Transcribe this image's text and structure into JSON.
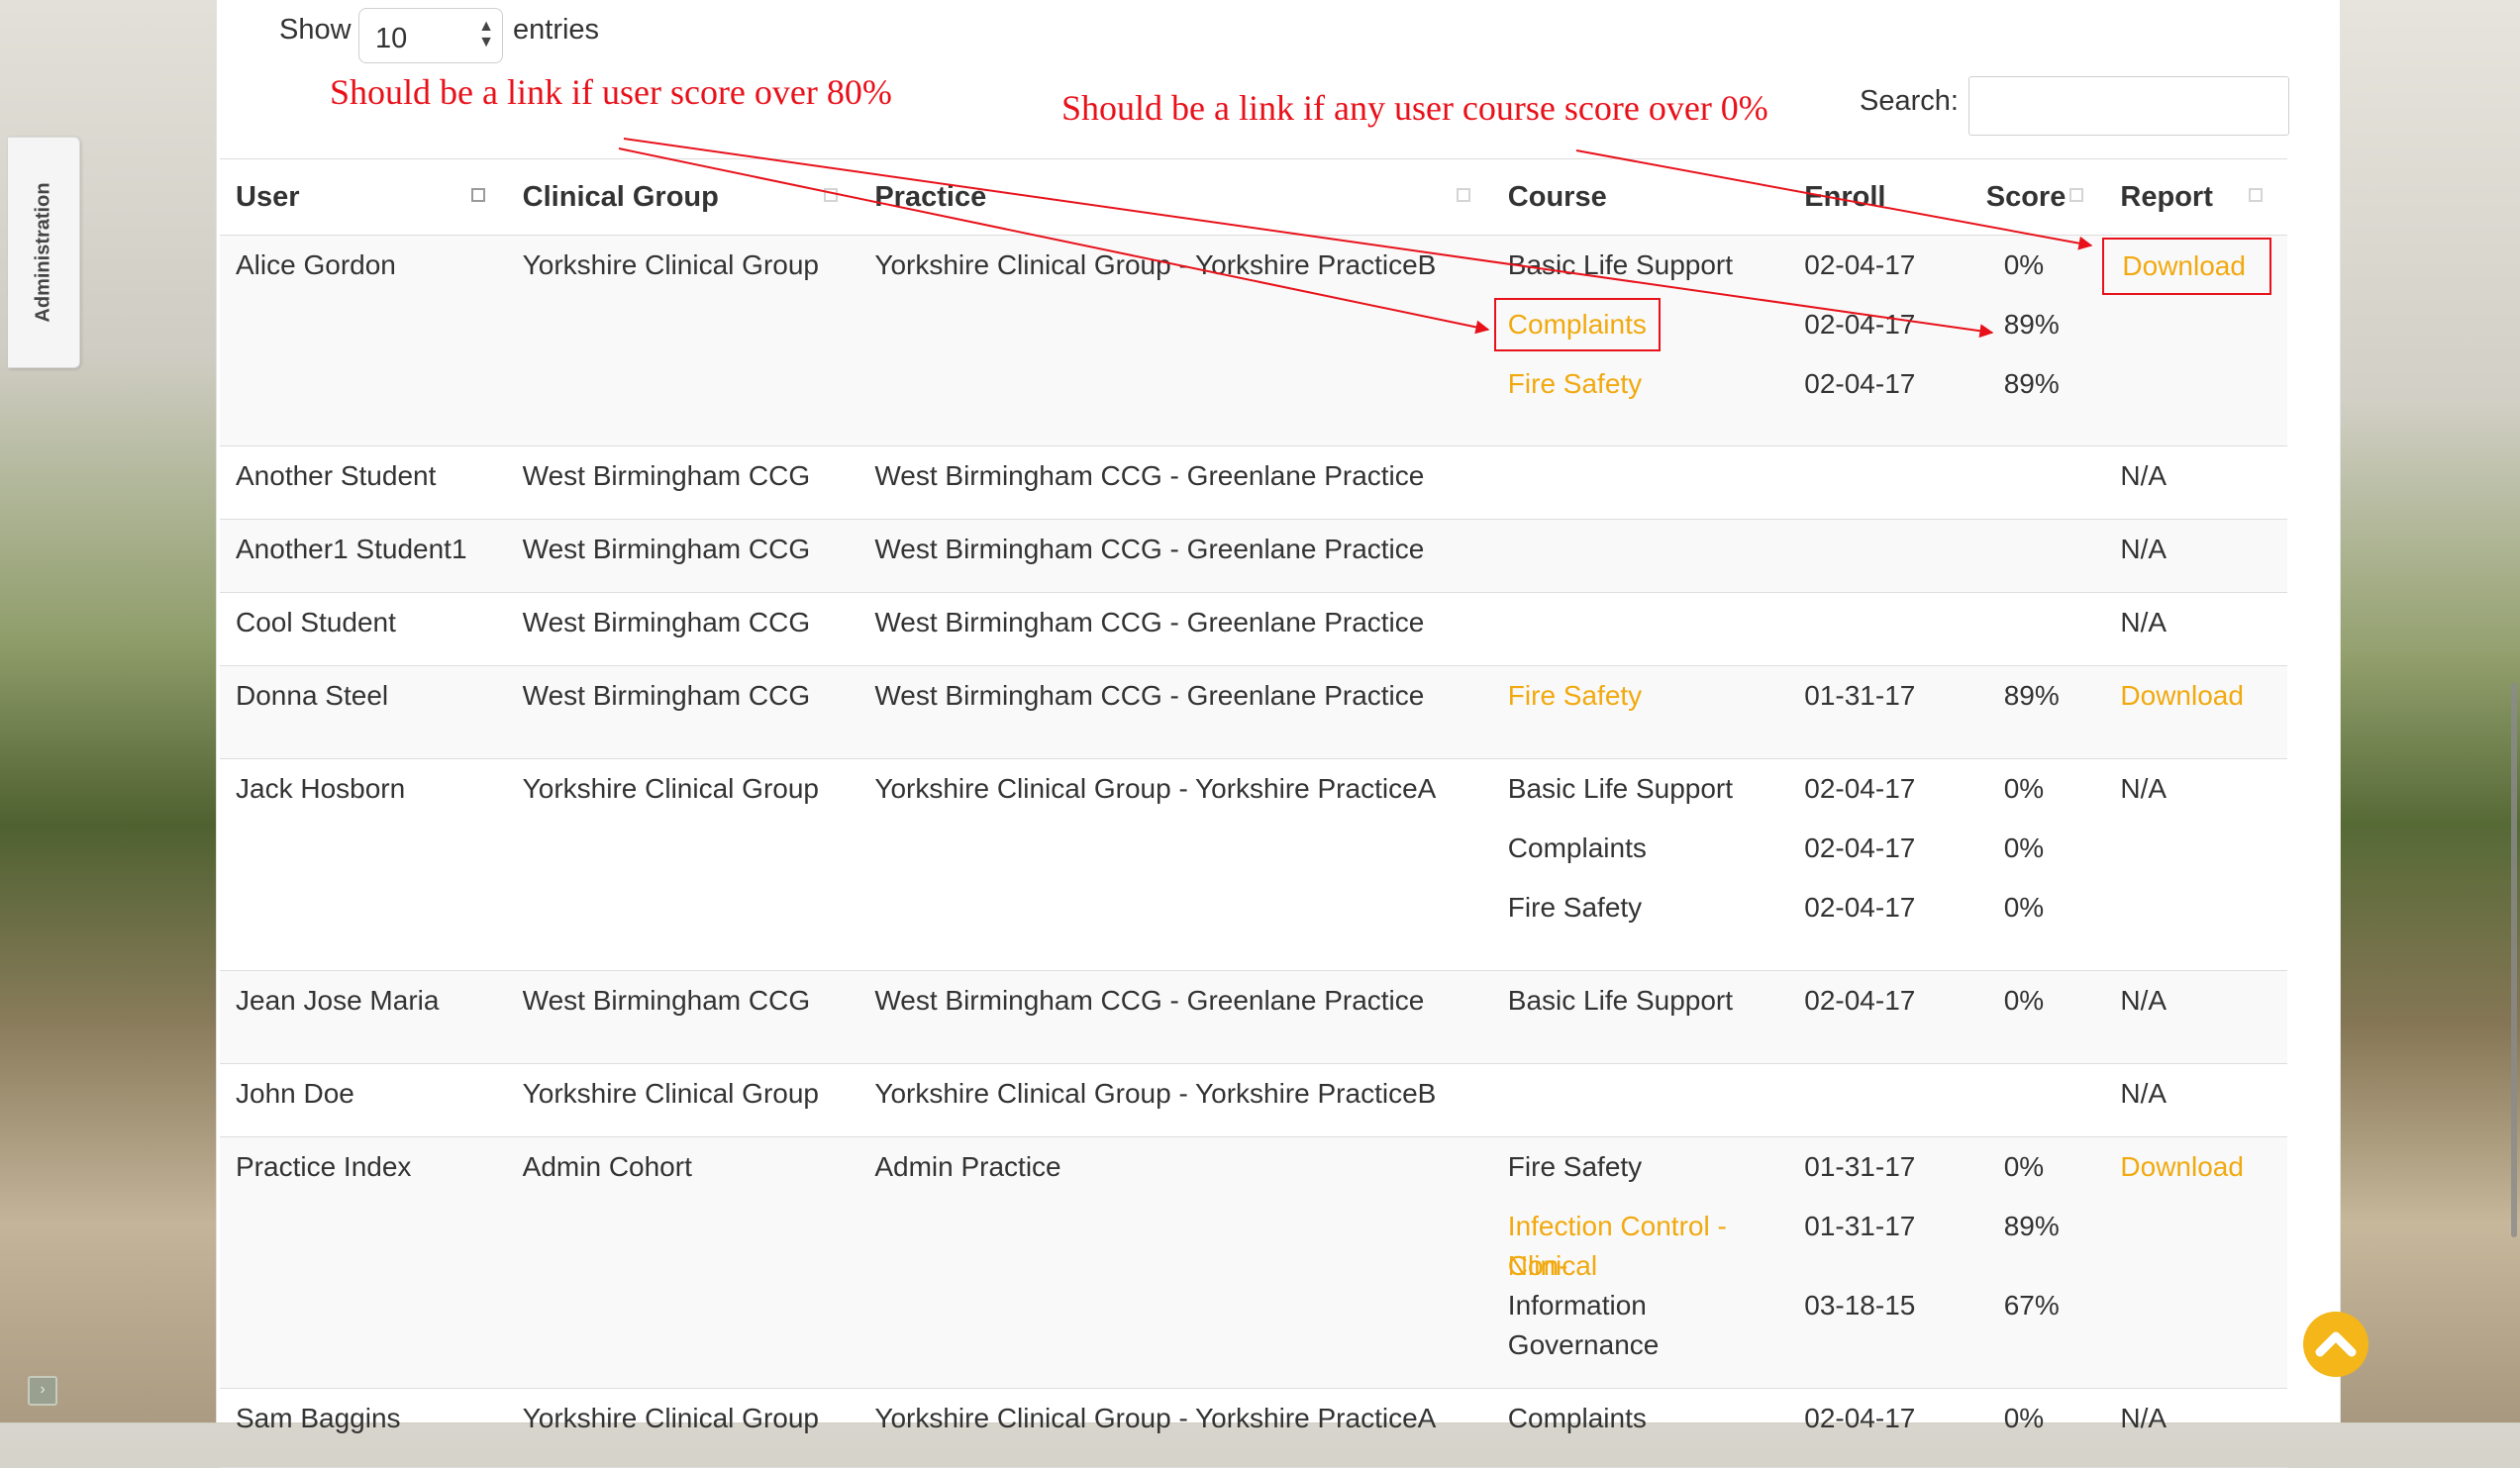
{
  "sidebar_tab": {
    "label": "Administration"
  },
  "controls": {
    "show_label": "Show",
    "page_size": "10",
    "entries_label": "entries",
    "search_label": "Search:",
    "search_value": ""
  },
  "annotations": {
    "left": "Should be a link if user score over 80%",
    "right": "Should be a link if any user course score over 0%"
  },
  "colors": {
    "link": "#f1a90f",
    "annotation": "#e8111a",
    "top_button": "#f4b618"
  },
  "icons": [
    "sort-icon",
    "chevron-up-icon",
    "select-arrows-icon"
  ],
  "table": {
    "headers": {
      "user": "User",
      "group": "Clinical Group",
      "practice": "Practice",
      "course": "Course",
      "enroll": "Enroll",
      "score": "Score",
      "report": "Report"
    },
    "rows": [
      {
        "user": "Alice Gordon",
        "group": "Yorkshire Clinical Group",
        "practice": "Yorkshire Clinical Group - Yorkshire PracticeB",
        "courses": [
          {
            "name": "Basic Life Support",
            "enroll": "02-04-17",
            "score": "0%"
          },
          {
            "name": "Complaints",
            "enroll": "02-04-17",
            "score": "89%"
          },
          {
            "name": "Fire Safety",
            "enroll": "02-04-17",
            "score": "89%"
          }
        ],
        "report": "Download"
      },
      {
        "user": "Another Student",
        "group": "West Birmingham CCG",
        "practice": "West Birmingham CCG - Greenlane Practice",
        "courses": [],
        "report": "N/A"
      },
      {
        "user": "Another1 Student1",
        "group": "West Birmingham CCG",
        "practice": "West Birmingham CCG - Greenlane Practice",
        "courses": [],
        "report": "N/A"
      },
      {
        "user": "Cool Student",
        "group": "West Birmingham CCG",
        "practice": "West Birmingham CCG - Greenlane Practice",
        "courses": [],
        "report": "N/A"
      },
      {
        "user": "Donna Steel",
        "group": "West Birmingham CCG",
        "practice": "West Birmingham CCG - Greenlane Practice",
        "courses": [
          {
            "name": "Fire Safety",
            "enroll": "01-31-17",
            "score": "89%"
          }
        ],
        "report": "Download"
      },
      {
        "user": "Jack Hosborn",
        "group": "Yorkshire Clinical Group",
        "practice": "Yorkshire Clinical Group - Yorkshire PracticeA",
        "courses": [
          {
            "name": "Basic Life Support",
            "enroll": "02-04-17",
            "score": "0%"
          },
          {
            "name": "Complaints",
            "enroll": "02-04-17",
            "score": "0%"
          },
          {
            "name": "Fire Safety",
            "enroll": "02-04-17",
            "score": "0%"
          }
        ],
        "report": "N/A"
      },
      {
        "user": "Jean Jose Maria",
        "group": "West Birmingham CCG",
        "practice": "West Birmingham CCG - Greenlane Practice",
        "courses": [
          {
            "name": "Basic Life Support",
            "enroll": "02-04-17",
            "score": "0%"
          }
        ],
        "report": "N/A"
      },
      {
        "user": "John Doe",
        "group": "Yorkshire Clinical Group",
        "practice": "Yorkshire Clinical Group - Yorkshire PracticeB",
        "courses": [],
        "report": "N/A"
      },
      {
        "user": "Practice Index",
        "group": "Admin Cohort",
        "practice": "Admin Practice",
        "courses": [
          {
            "name": "Fire Safety",
            "enroll": "01-31-17",
            "score": "0%"
          },
          {
            "name_line1": "Infection Control - Non-",
            "name_line2": "Clinical",
            "enroll": "01-31-17",
            "score": "89%"
          },
          {
            "name_line1": "Information",
            "name_line2": "Governance",
            "enroll": "03-18-15",
            "score": "67%"
          }
        ],
        "report": "Download"
      },
      {
        "user": "Sam Baggins",
        "group": "Yorkshire Clinical Group",
        "practice": "Yorkshire Clinical Group - Yorkshire PracticeA",
        "courses": [
          {
            "name": "Complaints",
            "enroll": "02-04-17",
            "score": "0%"
          }
        ],
        "report": "N/A"
      }
    ]
  }
}
